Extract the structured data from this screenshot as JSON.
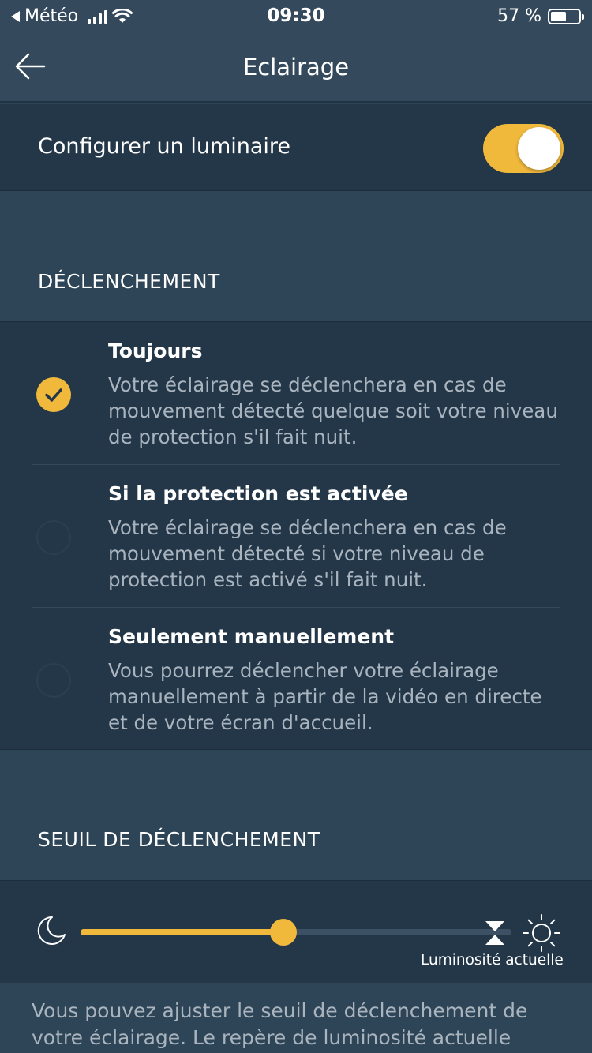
{
  "status_bar": {
    "back_app": "Météo",
    "time": "09:30",
    "battery": "57 %",
    "battery_level": 0.57
  },
  "nav": {
    "title": "Eclairage"
  },
  "configure": {
    "label": "Configurer un luminaire",
    "enabled": true
  },
  "trigger_section": {
    "header": "DÉCLENCHEMENT",
    "options": [
      {
        "title": "Toujours",
        "description": "Votre éclairage se déclenchera en cas de mouvement détecté quelque soit votre niveau de protection s'il fait nuit.",
        "selected": true
      },
      {
        "title": "Si la protection est activée",
        "description": "Votre éclairage se déclenchera en cas de mouvement détecté si votre niveau de protection est activé s'il fait nuit.",
        "selected": false
      },
      {
        "title": "Seulement manuellement",
        "description": "Vous pourrez déclencher votre éclairage manuellement à partir de la vidéo en directe et de votre écran d'accueil.",
        "selected": false
      }
    ]
  },
  "threshold_section": {
    "header": "SEUIL DE DÉCLENCHEMENT",
    "slider_value": 0.47,
    "current_marker_value": 0.96,
    "marker_label": "Luminosité actuelle",
    "footer": "Vous pouvez ajuster le seuil de déclenchement de votre éclairage. Le repère de luminosité actuelle"
  },
  "colors": {
    "accent": "#f1b93c",
    "background": "#2e4557",
    "panel": "#233749"
  }
}
